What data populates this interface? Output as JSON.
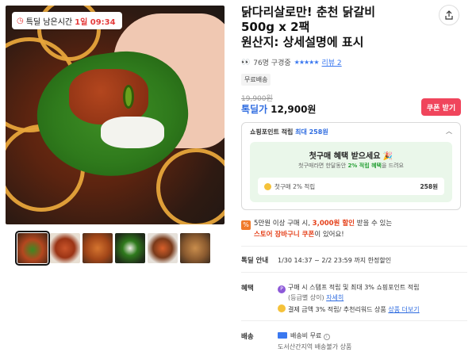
{
  "gallery": {
    "timer_label": "특딜 남은시간",
    "timer_value": "1일 09:34",
    "thumb_count": 6
  },
  "product": {
    "title_line1": "닭다리살로만! 춘천 닭갈비",
    "title_line2": "500g x 2팩",
    "title_line3": "원산지: 상세설명에 표시",
    "viewers": "76명 구경중",
    "stars": "★★★★★",
    "review_label": "리뷰 2",
    "tag": "무료배송",
    "original_price": "19,900원",
    "price_label": "톡딜가",
    "price": "12,900원",
    "coupon_button": "쿠폰 받기"
  },
  "points": {
    "head": "쇼핑포인트 적립",
    "head_max": "최대 258원",
    "first_title": "첫구매 혜택 받으세요",
    "first_sub_pre": "첫구매라면 한달동안",
    "first_sub_green": "2% 적립 혜택",
    "first_sub_post": "을 드려요",
    "row_label": "첫구매 2% 적립",
    "row_amount": "258원"
  },
  "promo": {
    "line1_pre": "5만원 이상 구매 시,",
    "line1_red": "3,000원 할인",
    "line1_post": "받을 수 있는",
    "line2_red": "스토어 장바구니 쿠폰",
    "line2_post": "이 있어요!"
  },
  "deal": {
    "label": "톡딜 안내",
    "value": "1/30 14:37 ~ 2/2 23:59 까지 한정할인"
  },
  "benefit": {
    "label": "혜택",
    "line1": "구매 시 스탬프 적립 및 최대 3% 쇼핑포인트 적립",
    "line2_pre": "(등급별 상이)",
    "line2_link": "자세히",
    "line3_pre": "결제 금액 3% 적립/ 추천리워드 상품",
    "line3_link": "상품 더보기"
  },
  "shipping": {
    "label": "배송",
    "line1": "배송비 무료",
    "line2": "도서산간지역 배송불가 상품"
  },
  "colors": {
    "accent_blue": "#2f6ce0",
    "coupon_red": "#f0455c",
    "promo_red": "#e5401a",
    "green_bg": "#eaf7ea"
  }
}
